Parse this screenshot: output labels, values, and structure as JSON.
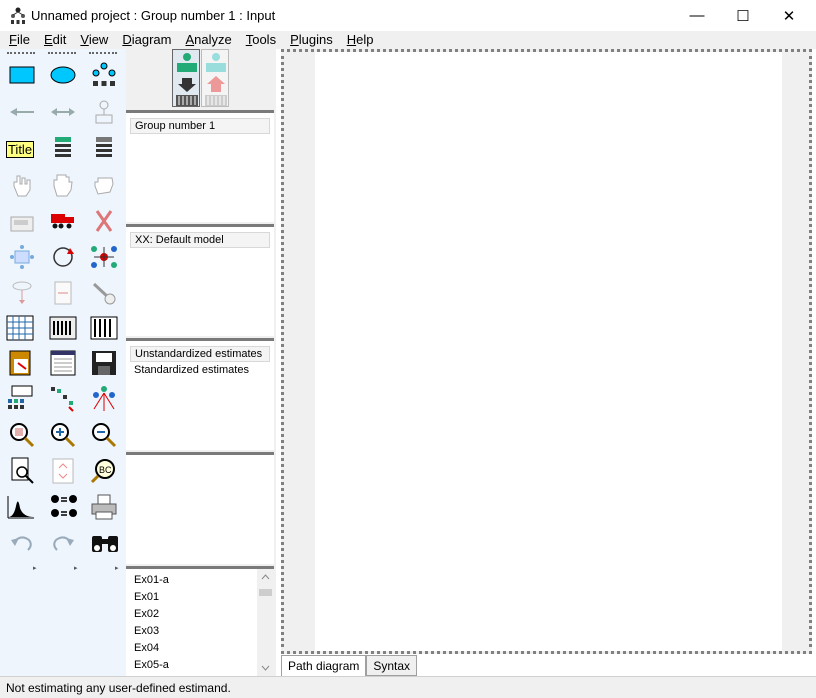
{
  "window": {
    "title": "Unnamed project : Group number 1 : Input",
    "min_glyph": "—",
    "max_glyph": "☐",
    "close_glyph": "✕"
  },
  "menu": [
    {
      "label": "File",
      "u": "F",
      "rest": "ile"
    },
    {
      "label": "Edit",
      "u": "E",
      "rest": "dit"
    },
    {
      "label": "View",
      "u": "V",
      "rest": "iew"
    },
    {
      "label": "Diagram",
      "u": "D",
      "rest": "iagram"
    },
    {
      "label": "Analyze",
      "u": "A",
      "rest": "nalyze"
    },
    {
      "label": "Tools",
      "u": "T",
      "rest": "ools"
    },
    {
      "label": "Plugins",
      "u": "P",
      "rest": "lugins"
    },
    {
      "label": "Help",
      "u": "H",
      "rest": "elp"
    }
  ],
  "toolbox": {
    "title_icon_text": "Title",
    "expand_glyph": "▸"
  },
  "groups": {
    "header": "Group number 1"
  },
  "models": {
    "header": "XX: Default model"
  },
  "estimates": {
    "selected": "Unstandardized estimates",
    "other": "Standardized estimates"
  },
  "files": [
    "Ex01-a",
    "Ex01",
    "Ex02",
    "Ex03",
    "Ex04",
    "Ex05-a"
  ],
  "tabs": {
    "path": "Path diagram",
    "syntax": "Syntax"
  },
  "status": "Not estimating any user-defined estimand.",
  "colors": {
    "accent_cyan": "#00c8ff",
    "toolbox_bg": "#eef5fd"
  }
}
